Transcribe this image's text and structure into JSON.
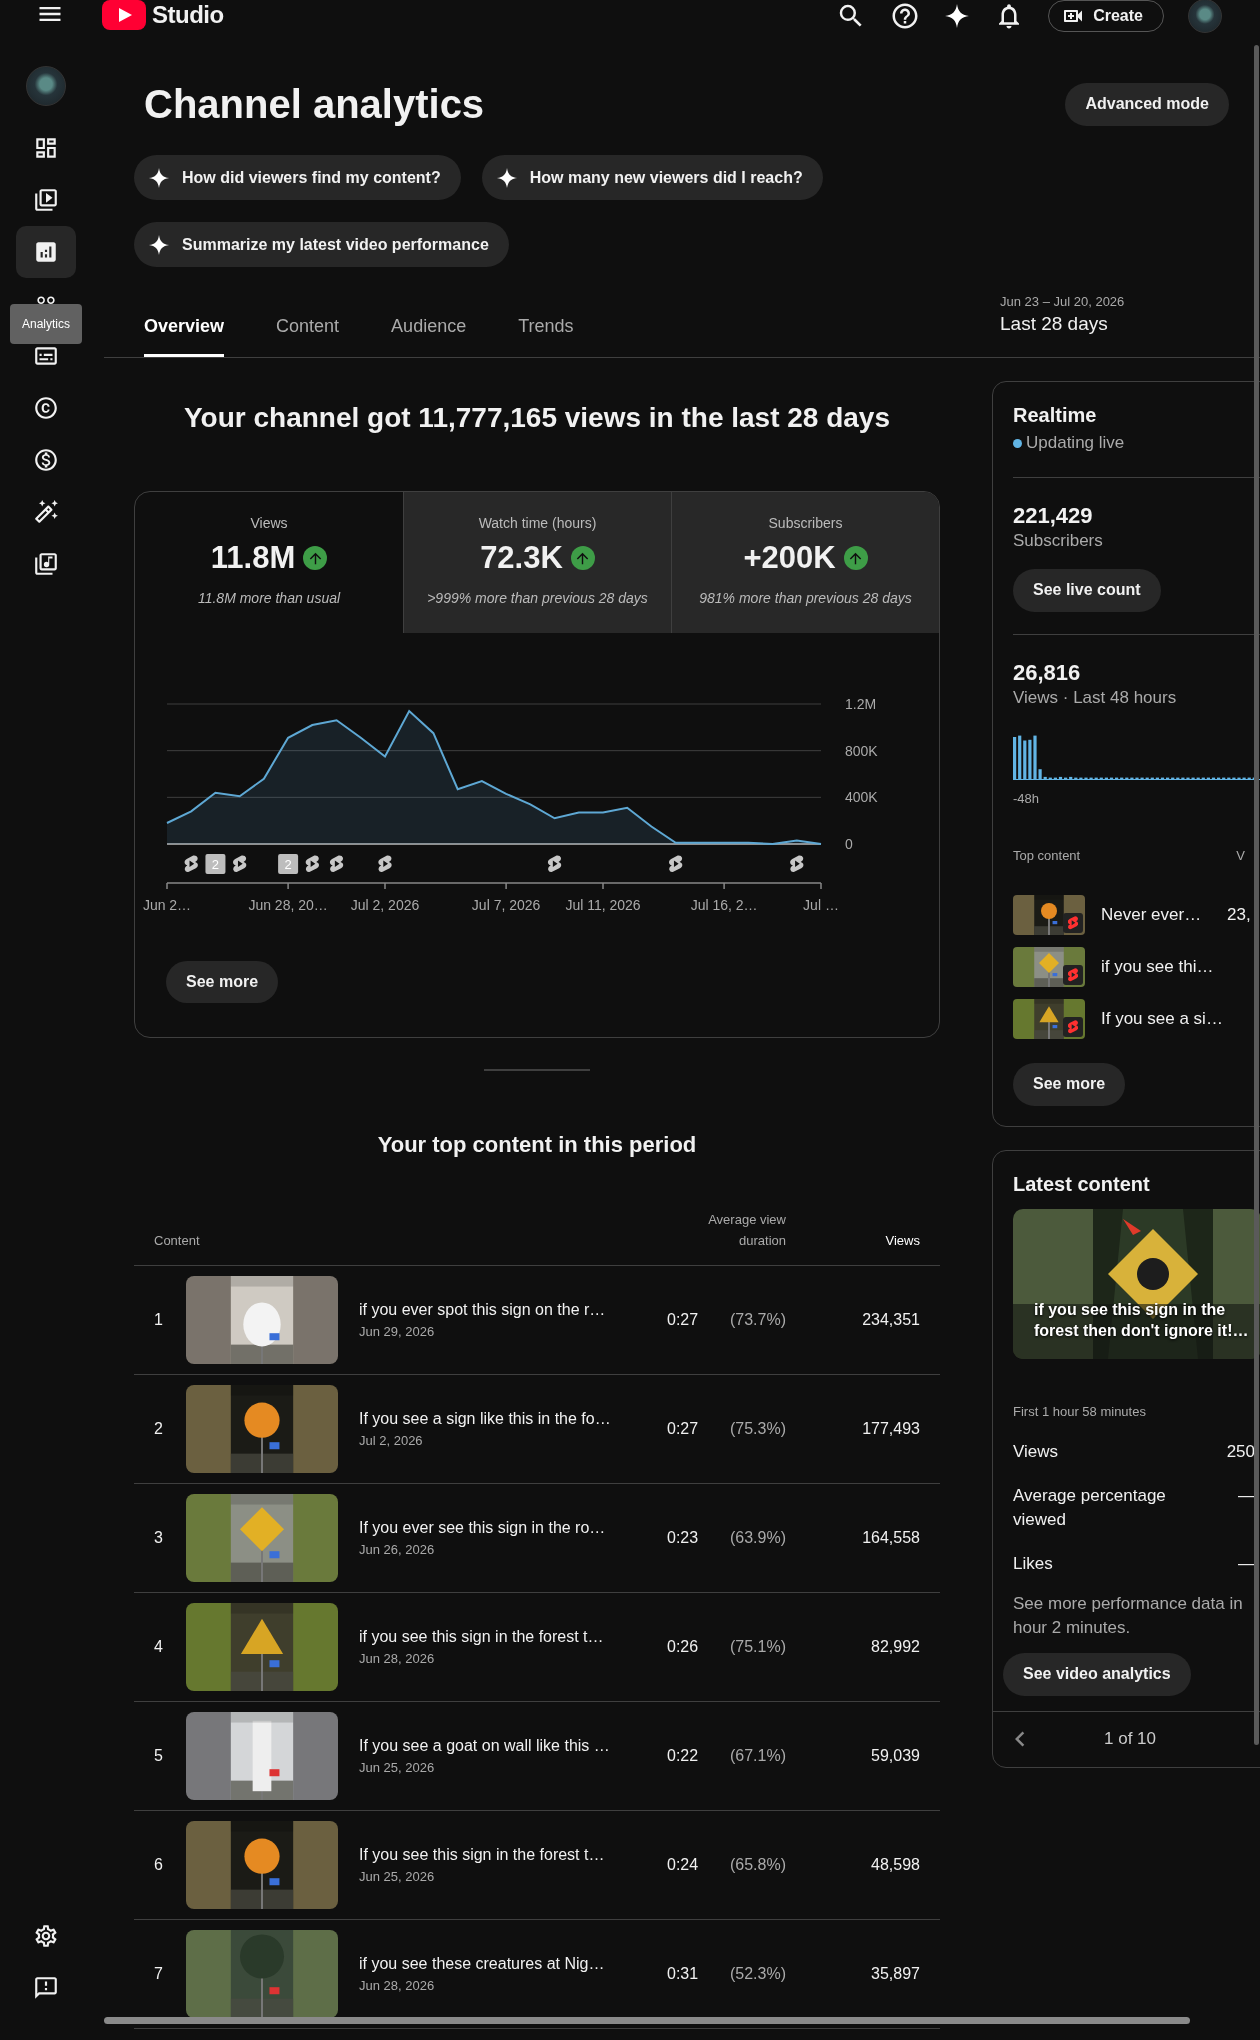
{
  "header": {
    "logo": "Studio",
    "create": "Create"
  },
  "sidebar": {
    "items": [
      {
        "kind": "dashboard",
        "selected": false
      },
      {
        "kind": "content",
        "selected": false
      },
      {
        "kind": "analytics",
        "selected": true
      },
      {
        "kind": "community",
        "selected": false
      },
      {
        "kind": "subtitles",
        "selected": false
      },
      {
        "kind": "copyright",
        "selected": false
      },
      {
        "kind": "earn",
        "selected": false
      },
      {
        "kind": "customization",
        "selected": false
      },
      {
        "kind": "audio",
        "selected": false
      }
    ],
    "tooltip": "Analytics",
    "bottom_items": [
      {
        "kind": "settings"
      },
      {
        "kind": "feedback"
      }
    ]
  },
  "page": {
    "title": "Channel analytics",
    "advanced_button": "Advanced mode",
    "suggestions": [
      "How did viewers find my content?",
      "How many new viewers did I reach?",
      "Summarize my latest video performance"
    ],
    "tabs": [
      {
        "label": "Overview",
        "selected": true
      },
      {
        "label": "Content",
        "selected": false
      },
      {
        "label": "Audience",
        "selected": false
      },
      {
        "label": "Trends",
        "selected": false
      }
    ],
    "date_range": {
      "range": "Jun 23 – Jul 20, 2026",
      "label": "Last 28 days"
    }
  },
  "overview": {
    "headline": "Your channel got 11,777,165 views in the last 28 days",
    "metrics": [
      {
        "label": "Views",
        "value": "11.8M",
        "note": "11.8M more than usual",
        "selected": true
      },
      {
        "label": "Watch time (hours)",
        "value": "72.3K",
        "note": ">999% more than previous 28 days",
        "selected": false
      },
      {
        "label": "Subscribers",
        "value": "+200K",
        "note": "981% more than previous 28 days",
        "selected": false
      }
    ],
    "chart": {
      "chart_data": {
        "type": "area",
        "categories": [
          "Jun 2…",
          null,
          null,
          null,
          null,
          "Jun 28, 20…",
          null,
          null,
          null,
          "Jul 2, 2026",
          null,
          null,
          null,
          null,
          "Jul 7, 2026",
          null,
          null,
          null,
          "Jul 11, 2026",
          null,
          null,
          null,
          null,
          "Jul 16, 2…",
          null,
          null,
          null,
          "Jul …"
        ],
        "series": [
          {
            "color": "#5ea8d4",
            "values": [
              180000,
              280000,
              440000,
              410000,
              560000,
              910000,
              1020000,
              1060000,
              910000,
              750000,
              1140000,
              950000,
              470000,
              540000,
              430000,
              340000,
              220000,
              270000,
              270000,
              310000,
              150000,
              10000,
              10000,
              10000,
              10000,
              0,
              30000,
              0
            ]
          }
        ],
        "ylim": [
          0,
          1200000
        ],
        "yticks": [
          {
            "value": 0,
            "label": "0"
          },
          {
            "value": 400000,
            "label": "400K"
          },
          {
            "value": 800000,
            "label": "800K"
          },
          {
            "value": 1200000,
            "label": "1.2M"
          }
        ]
      },
      "markers": [
        {
          "kind": "none"
        },
        {
          "kind": "short"
        },
        {
          "kind": "group",
          "label": "2"
        },
        {
          "kind": "short"
        },
        {
          "kind": "none"
        },
        {
          "kind": "group",
          "label": "2"
        },
        {
          "kind": "short"
        },
        {
          "kind": "short"
        },
        {
          "kind": "none"
        },
        {
          "kind": "short"
        },
        {
          "kind": "none"
        },
        {
          "kind": "none"
        },
        {
          "kind": "none"
        },
        {
          "kind": "none"
        },
        {
          "kind": "none"
        },
        {
          "kind": "none"
        },
        {
          "kind": "short"
        },
        {
          "kind": "none"
        },
        {
          "kind": "none"
        },
        {
          "kind": "none"
        },
        {
          "kind": "none"
        },
        {
          "kind": "short"
        },
        {
          "kind": "none"
        },
        {
          "kind": "none"
        },
        {
          "kind": "none"
        },
        {
          "kind": "none"
        },
        {
          "kind": "short"
        },
        {
          "kind": "none"
        }
      ]
    },
    "see_more": "See more"
  },
  "top_content": {
    "title": "Your top content in this period",
    "columns": [
      "Content",
      "Average view duration",
      "Views"
    ],
    "rows": [
      {
        "rank": "1",
        "title": "if you ever spot this sign on the r…",
        "date": "Jun 29, 2026",
        "duration": "0:27",
        "percent": "(73.7%)",
        "views": "234,351"
      },
      {
        "rank": "2",
        "title": "If you see a sign like this in the fo…",
        "date": "Jul 2, 2026",
        "duration": "0:27",
        "percent": "(75.3%)",
        "views": "177,493"
      },
      {
        "rank": "3",
        "title": "If you ever see this sign in the ro…",
        "date": "Jun 26, 2026",
        "duration": "0:23",
        "percent": "(63.9%)",
        "views": "164,558"
      },
      {
        "rank": "4",
        "title": "if you see this sign in the forest t…",
        "date": "Jun 28, 2026",
        "duration": "0:26",
        "percent": "(75.1%)",
        "views": "82,992"
      },
      {
        "rank": "5",
        "title": "If you see a goat on wall like this …",
        "date": "Jun 25, 2026",
        "duration": "0:22",
        "percent": "(67.1%)",
        "views": "59,039"
      },
      {
        "rank": "6",
        "title": "If you see this sign in the forest t…",
        "date": "Jun 25, 2026",
        "duration": "0:24",
        "percent": "(65.8%)",
        "views": "48,598"
      },
      {
        "rank": "7",
        "title": "if you see these creatures at Nig…",
        "date": "Jun 28, 2026",
        "duration": "0:31",
        "percent": "(52.3%)",
        "views": "35,897"
      }
    ]
  },
  "realtime": {
    "title": "Realtime",
    "status": "Updating live",
    "subscribers": "221,429",
    "subscribers_label": "Subscribers",
    "live_button": "See live count",
    "views": "26,816",
    "views_label": "Views · Last 48 hours",
    "axis_label": "-48h",
    "top_label": "Top content",
    "views_col": "V",
    "items": [
      {
        "title": "Never ever…",
        "views": "23,"
      },
      {
        "title": "if you see thi…"
      },
      {
        "title": "If you see a si…"
      }
    ],
    "see_more": "See more"
  },
  "latest_content": {
    "title": "Latest content",
    "video_title": "if you see this sign in the forest then don't ignore it!…",
    "period": "First 1 hour 58 minutes",
    "stats": [
      {
        "label": "Views",
        "value": "250"
      },
      {
        "label": "Average percentage viewed",
        "value": "—"
      },
      {
        "label": "Likes",
        "value": "—"
      }
    ],
    "note": "See more performance data in hour 2 minutes.",
    "button": "See video analytics",
    "pager": "1 of 10"
  }
}
